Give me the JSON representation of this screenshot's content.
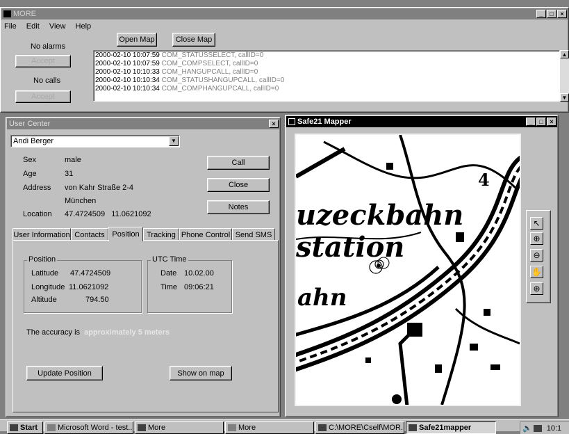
{
  "main_window": {
    "title": "MORE",
    "menu": [
      "File",
      "Edit",
      "View",
      "Help"
    ],
    "open_map": "Open Map",
    "close_map": "Close Map",
    "alarms_status": "No alarms",
    "alarms_accept": "Accept",
    "calls_status": "No calls",
    "calls_accept": "Accept",
    "log": [
      {
        "ts": "2000-02-10 10:07:59",
        "msg": "COM_STATUSSELECT, callID=0"
      },
      {
        "ts": "2000-02-10 10:07:59",
        "msg": "COM_COMPSELECT, callID=0"
      },
      {
        "ts": "2000-02-10 10:10:33",
        "msg": "COM_HANGUPCALL, callID=0"
      },
      {
        "ts": "2000-02-10 10:10:34",
        "msg": "COM_STATUSHANGUPCALL, callID=0"
      },
      {
        "ts": "2000-02-10 10:10:34",
        "msg": "COM_COMPHANGUPCALL, callID=0"
      }
    ]
  },
  "user_center": {
    "title": "User Center",
    "user_select": "Andi Berger",
    "labels": {
      "sex": "Sex",
      "age": "Age",
      "address": "Address",
      "location": "Location"
    },
    "values": {
      "sex": "male",
      "age": "31",
      "address_line1": "von Kahr Straße 2-4",
      "address_line2": "München",
      "location": "47.4724509   11.0621092"
    },
    "call": "Call",
    "close": "Close",
    "notes": "Notes",
    "tabs": [
      "User Information",
      "Contacts",
      "Position",
      "Tracking",
      "Phone Control",
      "Send SMS"
    ],
    "position": {
      "group_title": "Position",
      "latitude_label": "Latitude",
      "latitude": "47.4724509",
      "longitude_label": "Longitude",
      "longitude": "11.0621092",
      "altitude_label": "Altitude",
      "altitude": "794.50"
    },
    "utc": {
      "group_title": "UTC Time",
      "date_label": "Date",
      "date": "10.02.00",
      "time_label": "Time",
      "time": "09:06:21"
    },
    "accuracy_prefix": "The accuracy is",
    "accuracy_value": "approximately 5 meters",
    "update_position": "Update Position",
    "show_on_map": "Show on map"
  },
  "mapper": {
    "title": "Safe21 Mapper",
    "map_text": [
      "uzeckbahn",
      "station",
      "ahn"
    ],
    "map_digit": "4"
  },
  "taskbar": {
    "start": "Start",
    "items": [
      "Microsoft Word - test...",
      "More",
      "More",
      "C:\\MORE\\Cself\\MOR...",
      "Safe21mapper"
    ],
    "clock": "10:1"
  },
  "colors": {
    "face": "#c0c0c0",
    "active_title": "#000000",
    "inactive_title": "#808080",
    "accent_text": "#e0e0e0"
  }
}
